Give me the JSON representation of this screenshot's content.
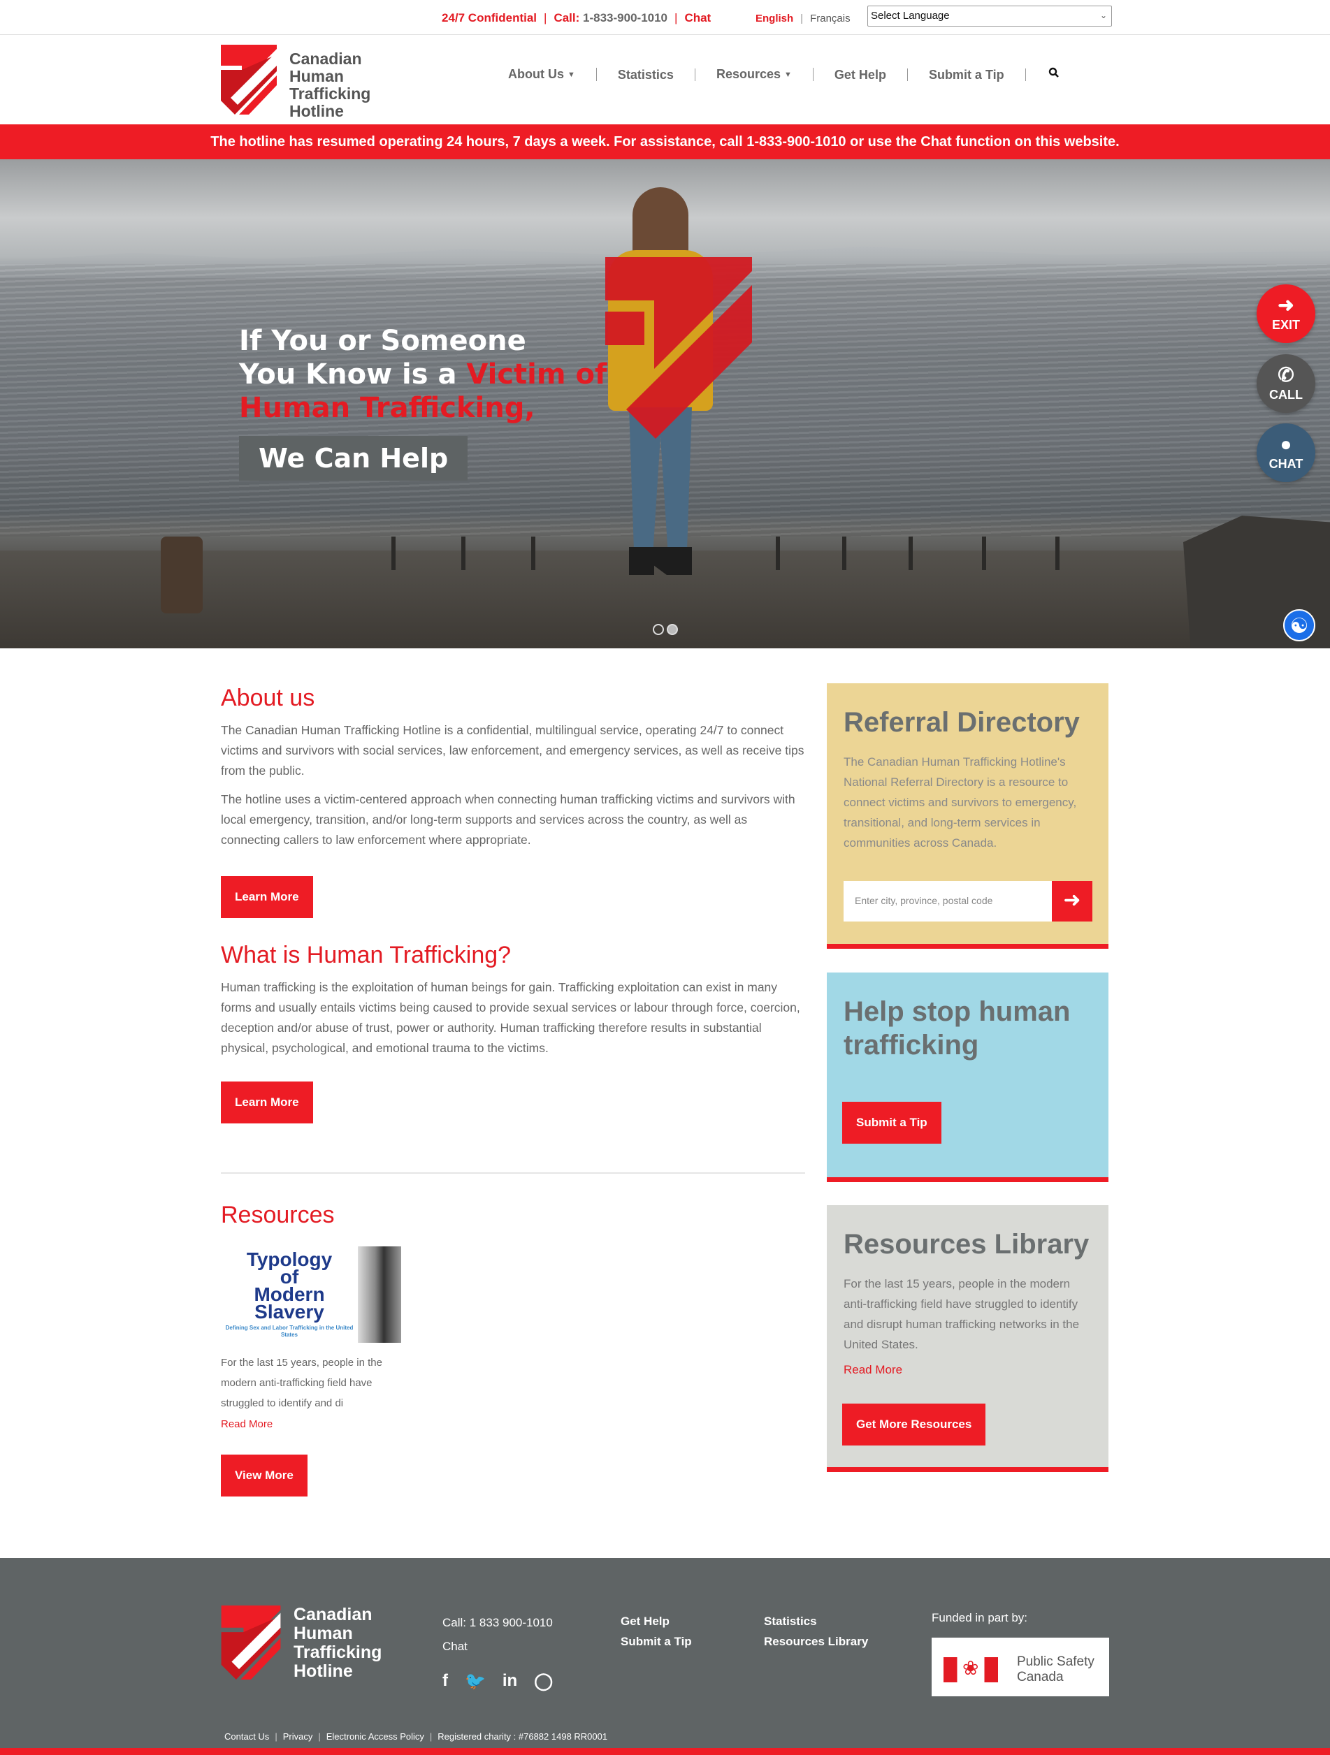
{
  "topbar": {
    "confidential": "24/7 Confidential",
    "call_label": "Call:",
    "call_number": "1-833-900-1010",
    "chat": "Chat",
    "lang_en": "English",
    "lang_fr": "Français",
    "select_language": "Select Language"
  },
  "logo": {
    "line1": "Canadian",
    "line2": "Human",
    "line3": "Trafficking",
    "line4": "Hotline"
  },
  "nav": {
    "items": [
      "About Us",
      "Statistics",
      "Resources",
      "Get Help",
      "Submit a Tip"
    ]
  },
  "alert": "The hotline has resumed operating 24 hours, 7 days a week. For assistance, call 1-833-900-1010 or use the Chat function on this website.",
  "hero": {
    "line1": "If You or Someone",
    "line2a": "You Know is a ",
    "line2b": "Victim of",
    "line3": "Human Trafficking,",
    "cta": "We Can Help"
  },
  "fab": {
    "exit": "EXIT",
    "call": "CALL",
    "chat": "CHAT"
  },
  "about": {
    "title": "About us",
    "p1": "The Canadian Human Trafficking Hotline is a confidential, multilingual service, operating 24/7 to connect victims and survivors with social services, law enforcement, and emergency services, as well as receive tips from the public.",
    "p2": "The hotline uses a victim-centered approach when connecting human trafficking victims and survivors with local emergency, transition, and/or long-term supports and services across the country, as well as connecting callers to law enforcement where appropriate.",
    "button": "Learn More"
  },
  "what": {
    "title": "What is Human Trafficking?",
    "p1": "Human trafficking is the exploitation of human beings for gain. Trafficking exploitation can exist in many forms and usually entails victims being caused to provide sexual services or labour through force, coercion, deception and/or abuse of trust, power or authority. Human trafficking therefore results in substantial physical, psychological, and emotional trauma to the victims.",
    "button": "Learn More"
  },
  "resources": {
    "title": "Resources",
    "book_title_1": "Typology",
    "book_title_2": "of",
    "book_title_3": "Modern",
    "book_title_4": "Slavery",
    "book_subtitle": "Defining Sex and Labor Trafficking in the United States",
    "excerpt": "For the last 15 years, people in the modern anti-trafficking field have struggled to identify and di",
    "read_more": "Read More",
    "button": "View More"
  },
  "referral": {
    "title": "Referral Directory",
    "body": "The Canadian Human Trafficking Hotline's National Referral Directory is a resource to connect victims and survivors to emergency, transitional, and long-term services in communities across Canada.",
    "placeholder": "Enter city, province, postal code"
  },
  "tip": {
    "title": "Help stop human trafficking",
    "button": "Submit a Tip"
  },
  "library": {
    "title": "Resources Library",
    "body": "For the last 15 years, people in the modern anti-trafficking field have struggled to identify and disrupt human trafficking networks in the United States.",
    "read_more": "Read More",
    "button": "Get More Resources"
  },
  "footer": {
    "call": "Call: 1 833 900-1010",
    "chat": "Chat",
    "get_help": "Get Help",
    "submit_tip": "Submit a Tip",
    "statistics": "Statistics",
    "resources_library": "Resources Library",
    "funded": "Funded in part by:",
    "psc_line1": "Public Safety",
    "psc_line2": "Canada",
    "legal": [
      "Contact Us",
      "Privacy",
      "Electronic Access Policy",
      "Registered charity : #76882 1498 RR0001"
    ]
  },
  "colors": {
    "brand_red": "#ee1c25",
    "dark_gray": "#5f6465",
    "referral_bg": "#ecd595",
    "tip_bg": "#a1d8e6",
    "library_bg": "#d9dad6"
  }
}
